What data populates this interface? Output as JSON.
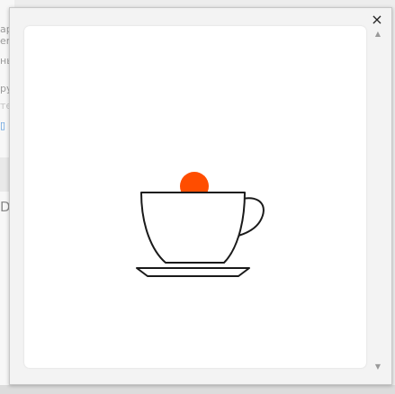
{
  "background": {
    "text_lines": [
      "ap",
      "er",
      "нь",
      "ру",
      "те"
    ],
    "heading_fragment": "Da"
  },
  "dialog": {
    "close_label": "×",
    "scroll_up": "▲",
    "scroll_down": "▼",
    "illustration": {
      "icon": "coffee-cup-icon",
      "stroke_color": "#1a1a1a",
      "dot_color": "#ff4d00"
    }
  }
}
